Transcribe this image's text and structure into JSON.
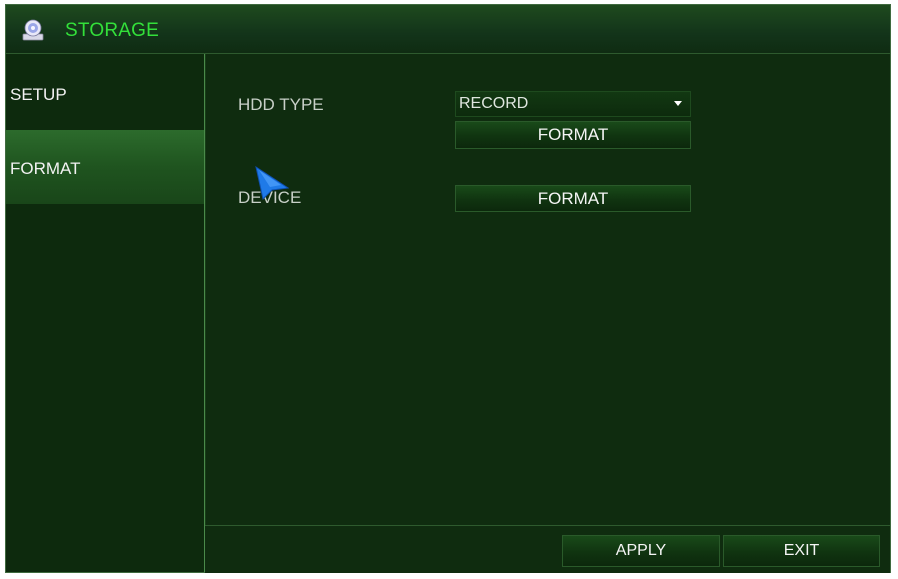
{
  "window": {
    "title": "STORAGE",
    "title_icon": "disc-drive-icon"
  },
  "sidebar": {
    "items": [
      {
        "label": "SETUP",
        "selected": false
      },
      {
        "label": "FORMAT",
        "selected": true
      }
    ]
  },
  "main": {
    "hdd_type": {
      "label": "HDD TYPE",
      "selected_value": "RECORD",
      "format_label": "FORMAT"
    },
    "device": {
      "label": "DEVICE",
      "format_label": "FORMAT"
    }
  },
  "footer": {
    "apply_label": "APPLY",
    "exit_label": "EXIT"
  },
  "colors": {
    "background": "#0f2c0f",
    "title_text": "#33e03a",
    "selected_item": "#2c6b2c",
    "cursor": "#1f7ae8"
  }
}
